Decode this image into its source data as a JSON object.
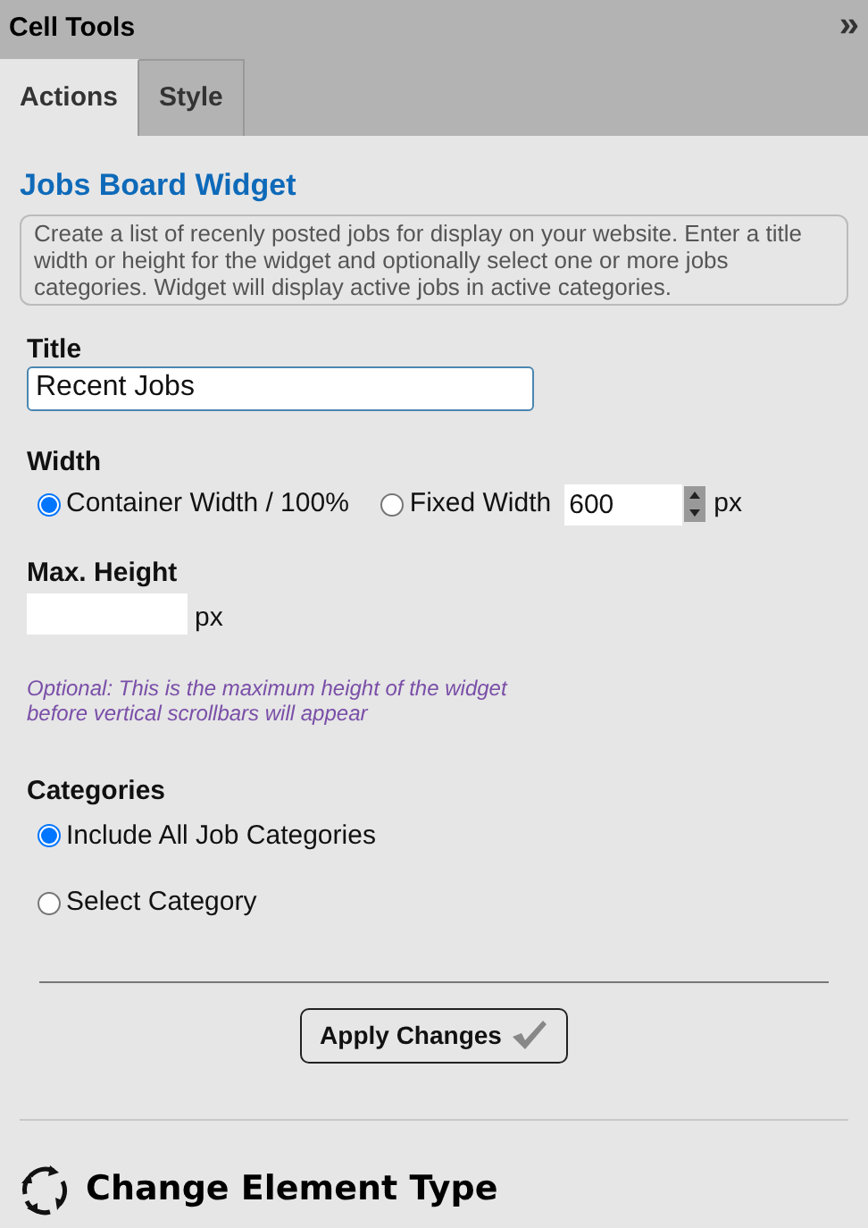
{
  "panel": {
    "title": "Cell Tools",
    "collapse": "»"
  },
  "tabs": [
    {
      "label": "Actions",
      "selected": true
    },
    {
      "label": "Style",
      "selected": false
    }
  ],
  "heading": "Jobs Board Widget",
  "description": "Create a list of recenly posted jobs for display on your website. Enter a title width or height for the widget and optionally select one or more jobs categories. Widget will display active jobs in active categories.",
  "title_field": {
    "label": "Title",
    "value": "Recent Jobs"
  },
  "width": {
    "label": "Width",
    "options": [
      {
        "label": "Container Width / 100%",
        "selected": true
      },
      {
        "label": "Fixed Width",
        "selected": false
      }
    ],
    "fixed_value": "600",
    "unit": "px"
  },
  "max_height": {
    "label": "Max. Height",
    "unit": "px",
    "note_lines": [
      "Optional: This is the maximum height of the widget",
      "before vertical scrollbars will appear"
    ]
  },
  "categories": {
    "label": "Categories",
    "options": [
      {
        "label": "Include All Job Categories",
        "selected": true
      },
      {
        "label": "Select Category",
        "selected": false
      }
    ]
  },
  "apply_button": "Apply Changes",
  "change_element": "Change Element Type"
}
